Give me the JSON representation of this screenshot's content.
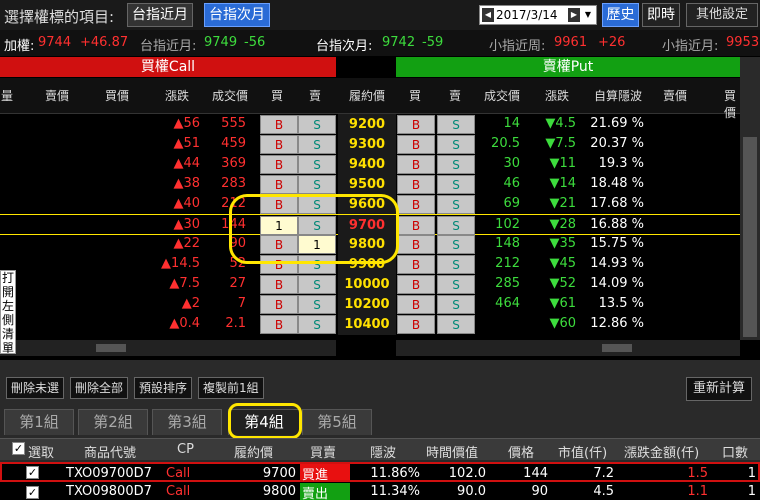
{
  "topbar": {
    "select_label": "選擇權標的項目:",
    "tab_near": "台指近月",
    "tab_next": "台指次月",
    "date": "2017/3/14",
    "history": "歷史",
    "realtime": "即時",
    "settings": "其他設定"
  },
  "ticker": {
    "taiex_label": "加權:",
    "taiex_value": "9744",
    "taiex_change": "+46.87",
    "near_label": "台指近月:",
    "near_value": "9749",
    "near_change": "-56",
    "next_label": "台指次月:",
    "next_value": "9742",
    "next_change": "-59",
    "mini_label": "小指近周:",
    "mini_value": "9961",
    "mini_change": "+26",
    "mini2_label": "小指近月:",
    "mini2_value": "9953"
  },
  "chain": {
    "call_title": "買權Call",
    "put_title": "賣權Put",
    "headers": {
      "qty": "量",
      "ask": "賣價",
      "bid": "買價",
      "chg": "漲跌",
      "price": "成交價",
      "buy": "買",
      "sell": "賣",
      "strike": "履約價",
      "iv": "自算隱波",
      "ask2": "賣價",
      "bid2": "買價"
    },
    "rows": [
      {
        "call_chg": "▲56",
        "call_price": "555",
        "call_b": "B",
        "call_s": "S",
        "strike": "9200",
        "put_b": "B",
        "put_s": "S",
        "put_price": "14",
        "put_chg": "▼4.5",
        "iv": "21.69 %"
      },
      {
        "call_chg": "▲51",
        "call_price": "459",
        "call_b": "B",
        "call_s": "S",
        "strike": "9300",
        "put_b": "B",
        "put_s": "S",
        "put_price": "20.5",
        "put_chg": "▼7.5",
        "iv": "20.37 %"
      },
      {
        "call_chg": "▲44",
        "call_price": "369",
        "call_b": "B",
        "call_s": "S",
        "strike": "9400",
        "put_b": "B",
        "put_s": "S",
        "put_price": "30",
        "put_chg": "▼11",
        "iv": "19.3 %"
      },
      {
        "call_chg": "▲38",
        "call_price": "283",
        "call_b": "B",
        "call_s": "S",
        "strike": "9500",
        "put_b": "B",
        "put_s": "S",
        "put_price": "46",
        "put_chg": "▼14",
        "iv": "18.48 %"
      },
      {
        "call_chg": "▲40",
        "call_price": "212",
        "call_b": "B",
        "call_s": "S",
        "strike": "9600",
        "put_b": "B",
        "put_s": "S",
        "put_price": "69",
        "put_chg": "▼21",
        "iv": "17.68 %"
      },
      {
        "call_chg": "▲30",
        "call_price": "144",
        "call_b": "1",
        "call_s": "S",
        "strike": "9700",
        "put_b": "B",
        "put_s": "S",
        "put_price": "102",
        "put_chg": "▼28",
        "iv": "16.88 %"
      },
      {
        "call_chg": "▲22",
        "call_price": "90",
        "call_b": "B",
        "call_s": "1",
        "strike": "9800",
        "put_b": "B",
        "put_s": "S",
        "put_price": "148",
        "put_chg": "▼35",
        "iv": "15.75 %"
      },
      {
        "call_chg": "▲14.5",
        "call_price": "52",
        "call_b": "B",
        "call_s": "S",
        "strike": "9900",
        "put_b": "B",
        "put_s": "S",
        "put_price": "212",
        "put_chg": "▼45",
        "iv": "14.93 %"
      },
      {
        "call_chg": "▲7.5",
        "call_price": "27",
        "call_b": "B",
        "call_s": "S",
        "strike": "10000",
        "put_b": "B",
        "put_s": "S",
        "put_price": "285",
        "put_chg": "▼52",
        "iv": "14.09 %"
      },
      {
        "call_chg": "▲2",
        "call_price": "7",
        "call_b": "B",
        "call_s": "S",
        "strike": "10200",
        "put_b": "B",
        "put_s": "S",
        "put_price": "464",
        "put_chg": "▼61",
        "iv": "13.5 %"
      },
      {
        "call_chg": "▲0.4",
        "call_price": "2.1",
        "call_b": "B",
        "call_s": "S",
        "strike": "10400",
        "put_b": "B",
        "put_s": "S",
        "put_price": "",
        "put_chg": "▼60",
        "iv": "12.86 %"
      }
    ]
  },
  "side_note": "打開左側清單",
  "actions": {
    "delete_unselected": "刪除未選",
    "delete_all": "刪除全部",
    "default_sort": "預設排序",
    "copy_prev": "複製前1組",
    "recalc": "重新計算"
  },
  "group_tabs": [
    "第1組",
    "第2組",
    "第3組",
    "第4組",
    "第5組"
  ],
  "active_group_index": 3,
  "position_table": {
    "headers": {
      "select": "選取",
      "code": "商品代號",
      "cp": "CP",
      "strike": "履約價",
      "side": "買賣",
      "iv": "隱波",
      "time_value": "時間價值",
      "price": "價格",
      "market_value": "市值(仟)",
      "pl": "漲跌金額(仟)",
      "qty": "口數"
    },
    "rows": [
      {
        "checked": "✓",
        "code": "TXO09700D7",
        "cp": "Call",
        "strike": "9700",
        "side": "買進",
        "iv": "11.86%",
        "time_value": "102.0",
        "price": "144",
        "market_value": "7.2",
        "pl": "1.5",
        "qty": "1"
      },
      {
        "checked": "✓",
        "code": "TXO09800D7",
        "cp": "Call",
        "strike": "9800",
        "side": "賣出",
        "iv": "11.34%",
        "time_value": "90.0",
        "price": "90",
        "market_value": "4.5",
        "pl": "1.1",
        "qty": "1"
      }
    ]
  },
  "colors": {
    "call_header": "#d01010",
    "put_header": "#12a012",
    "up": "#ff3030",
    "down": "#3ddc3d",
    "strike": "#ffe000",
    "highlight": "#ffe600",
    "active_tab": "#2a6bd6"
  }
}
